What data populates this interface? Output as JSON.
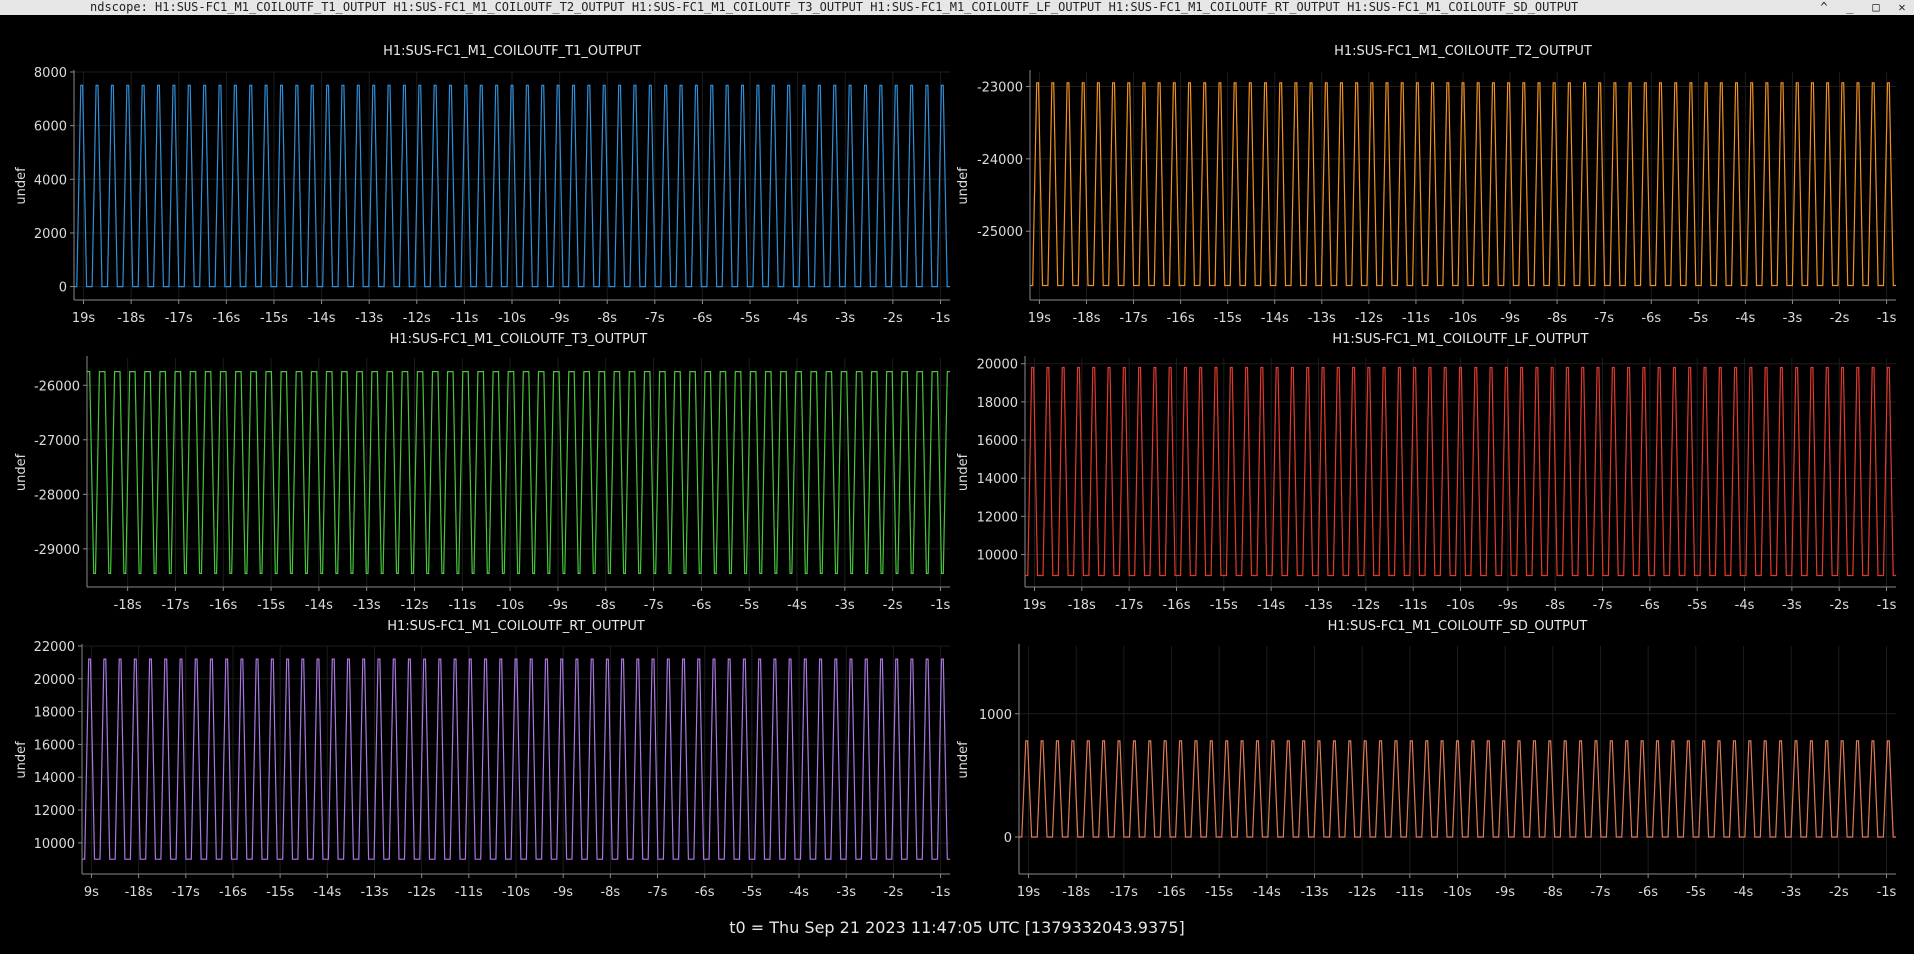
{
  "window": {
    "title": "ndscope: H1:SUS-FC1_M1_COILOUTF_T1_OUTPUT H1:SUS-FC1_M1_COILOUTF_T2_OUTPUT H1:SUS-FC1_M1_COILOUTF_T3_OUTPUT H1:SUS-FC1_M1_COILOUTF_LF_OUTPUT H1:SUS-FC1_M1_COILOUTF_RT_OUTPUT H1:SUS-FC1_M1_COILOUTF_SD_OUTPUT",
    "buttons": [
      "^",
      "_",
      "□",
      "✕"
    ]
  },
  "footer": {
    "t0_label": "t0 = Thu Sep 21 2023 11:47:05 UTC [1379332043.9375]"
  },
  "chart_data": [
    {
      "type": "line",
      "title": "H1:SUS-FC1_M1_COILOUTF_T1_OUTPUT",
      "ylabel": "undef",
      "color": "#2f8fd8",
      "xticks": [
        "19s",
        "-18s",
        "-17s",
        "-16s",
        "-15s",
        "-14s",
        "-13s",
        "-12s",
        "-11s",
        "-10s",
        "-9s",
        "-8s",
        "-7s",
        "-6s",
        "-5s",
        "-4s",
        "-3s",
        "-2s",
        "-1s"
      ],
      "yticks": [
        {
          "v": 0,
          "label": "0"
        },
        {
          "v": 2000,
          "label": "2000"
        },
        {
          "v": 4000,
          "label": "4000"
        },
        {
          "v": 6000,
          "label": "6000"
        },
        {
          "v": 8000,
          "label": "8000"
        }
      ],
      "xlim": [
        -19.2,
        -0.8
      ],
      "ylim": [
        -500,
        8000
      ],
      "wave": {
        "low": 0,
        "high": 7500,
        "periods": 57,
        "kind": "pulse"
      }
    },
    {
      "type": "line",
      "title": "H1:SUS-FC1_M1_COILOUTF_T2_OUTPUT",
      "ylabel": "undef",
      "color": "#f0911e",
      "xticks": [
        "19s",
        "-18s",
        "-17s",
        "-16s",
        "-15s",
        "-14s",
        "-13s",
        "-12s",
        "-11s",
        "-10s",
        "-9s",
        "-8s",
        "-7s",
        "-6s",
        "-5s",
        "-4s",
        "-3s",
        "-2s",
        "-1s"
      ],
      "yticks": [
        {
          "v": -25000,
          "label": "-25000"
        },
        {
          "v": -24000,
          "label": "-24000"
        },
        {
          "v": -23000,
          "label": "-23000"
        }
      ],
      "xlim": [
        -19.2,
        -0.8
      ],
      "ylim": [
        -25950,
        -22800
      ],
      "wave": {
        "low": -25750,
        "high": -22950,
        "periods": 57,
        "kind": "pulse"
      }
    },
    {
      "type": "line",
      "title": "H1:SUS-FC1_M1_COILOUTF_T3_OUTPUT",
      "ylabel": "undef",
      "color": "#47c63a",
      "xticks": [
        "-18s",
        "-17s",
        "-16s",
        "-15s",
        "-14s",
        "-13s",
        "-12s",
        "-11s",
        "-10s",
        "-9s",
        "-8s",
        "-7s",
        "-6s",
        "-5s",
        "-4s",
        "-3s",
        "-2s",
        "-1s"
      ],
      "yticks": [
        {
          "v": -29000,
          "label": "-29000"
        },
        {
          "v": -28000,
          "label": "-28000"
        },
        {
          "v": -27000,
          "label": "-27000"
        },
        {
          "v": -26000,
          "label": "-26000"
        }
      ],
      "xlim": [
        -18.85,
        -0.8
      ],
      "ylim": [
        -29700,
        -25500
      ],
      "wave": {
        "low": -29450,
        "high": -25750,
        "periods": 57,
        "kind": "inverted"
      }
    },
    {
      "type": "line",
      "title": "H1:SUS-FC1_M1_COILOUTF_LF_OUTPUT",
      "ylabel": "undef",
      "color": "#e03a2e",
      "xticks": [
        "19s",
        "-18s",
        "-17s",
        "-16s",
        "-15s",
        "-14s",
        "-13s",
        "-12s",
        "-11s",
        "-10s",
        "-9s",
        "-8s",
        "-7s",
        "-6s",
        "-5s",
        "-4s",
        "-3s",
        "-2s",
        "-1s"
      ],
      "yticks": [
        {
          "v": 10000,
          "label": "10000"
        },
        {
          "v": 12000,
          "label": "12000"
        },
        {
          "v": 14000,
          "label": "14000"
        },
        {
          "v": 16000,
          "label": "16000"
        },
        {
          "v": 18000,
          "label": "18000"
        },
        {
          "v": 20000,
          "label": "20000"
        }
      ],
      "xlim": [
        -19.2,
        -0.8
      ],
      "ylim": [
        8300,
        20300
      ],
      "wave": {
        "low": 8900,
        "high": 19800,
        "periods": 57,
        "kind": "pulse"
      }
    },
    {
      "type": "line",
      "title": "H1:SUS-FC1_M1_COILOUTF_RT_OUTPUT",
      "ylabel": "undef",
      "color": "#a877e0",
      "xticks": [
        "9s",
        "-18s",
        "-17s",
        "-16s",
        "-15s",
        "-14s",
        "-13s",
        "-12s",
        "-11s",
        "-10s",
        "-9s",
        "-8s",
        "-7s",
        "-6s",
        "-5s",
        "-4s",
        "-3s",
        "-2s",
        "-1s"
      ],
      "yticks": [
        {
          "v": 10000,
          "label": "10000"
        },
        {
          "v": 12000,
          "label": "12000"
        },
        {
          "v": 14000,
          "label": "14000"
        },
        {
          "v": 16000,
          "label": "16000"
        },
        {
          "v": 18000,
          "label": "18000"
        },
        {
          "v": 20000,
          "label": "20000"
        },
        {
          "v": 22000,
          "label": "22000"
        }
      ],
      "xlim": [
        -19.2,
        -0.8
      ],
      "ylim": [
        8100,
        22000
      ],
      "wave": {
        "low": 9000,
        "high": 21200,
        "periods": 57,
        "kind": "pulse"
      }
    },
    {
      "type": "line",
      "title": "H1:SUS-FC1_M1_COILOUTF_SD_OUTPUT",
      "ylabel": "undef",
      "color": "#e07a55",
      "xticks": [
        "19s",
        "-18s",
        "-17s",
        "-16s",
        "-15s",
        "-14s",
        "-13s",
        "-12s",
        "-11s",
        "-10s",
        "-9s",
        "-8s",
        "-7s",
        "-6s",
        "-5s",
        "-4s",
        "-3s",
        "-2s",
        "-1s"
      ],
      "yticks": [
        {
          "v": 0,
          "label": "0"
        },
        {
          "v": 1000,
          "label": "1000"
        }
      ],
      "xlim": [
        -19.2,
        -0.8
      ],
      "ylim": [
        -300,
        1550
      ],
      "wave": {
        "low": 0,
        "high": 780,
        "periods": 57,
        "kind": "pulse"
      }
    }
  ]
}
